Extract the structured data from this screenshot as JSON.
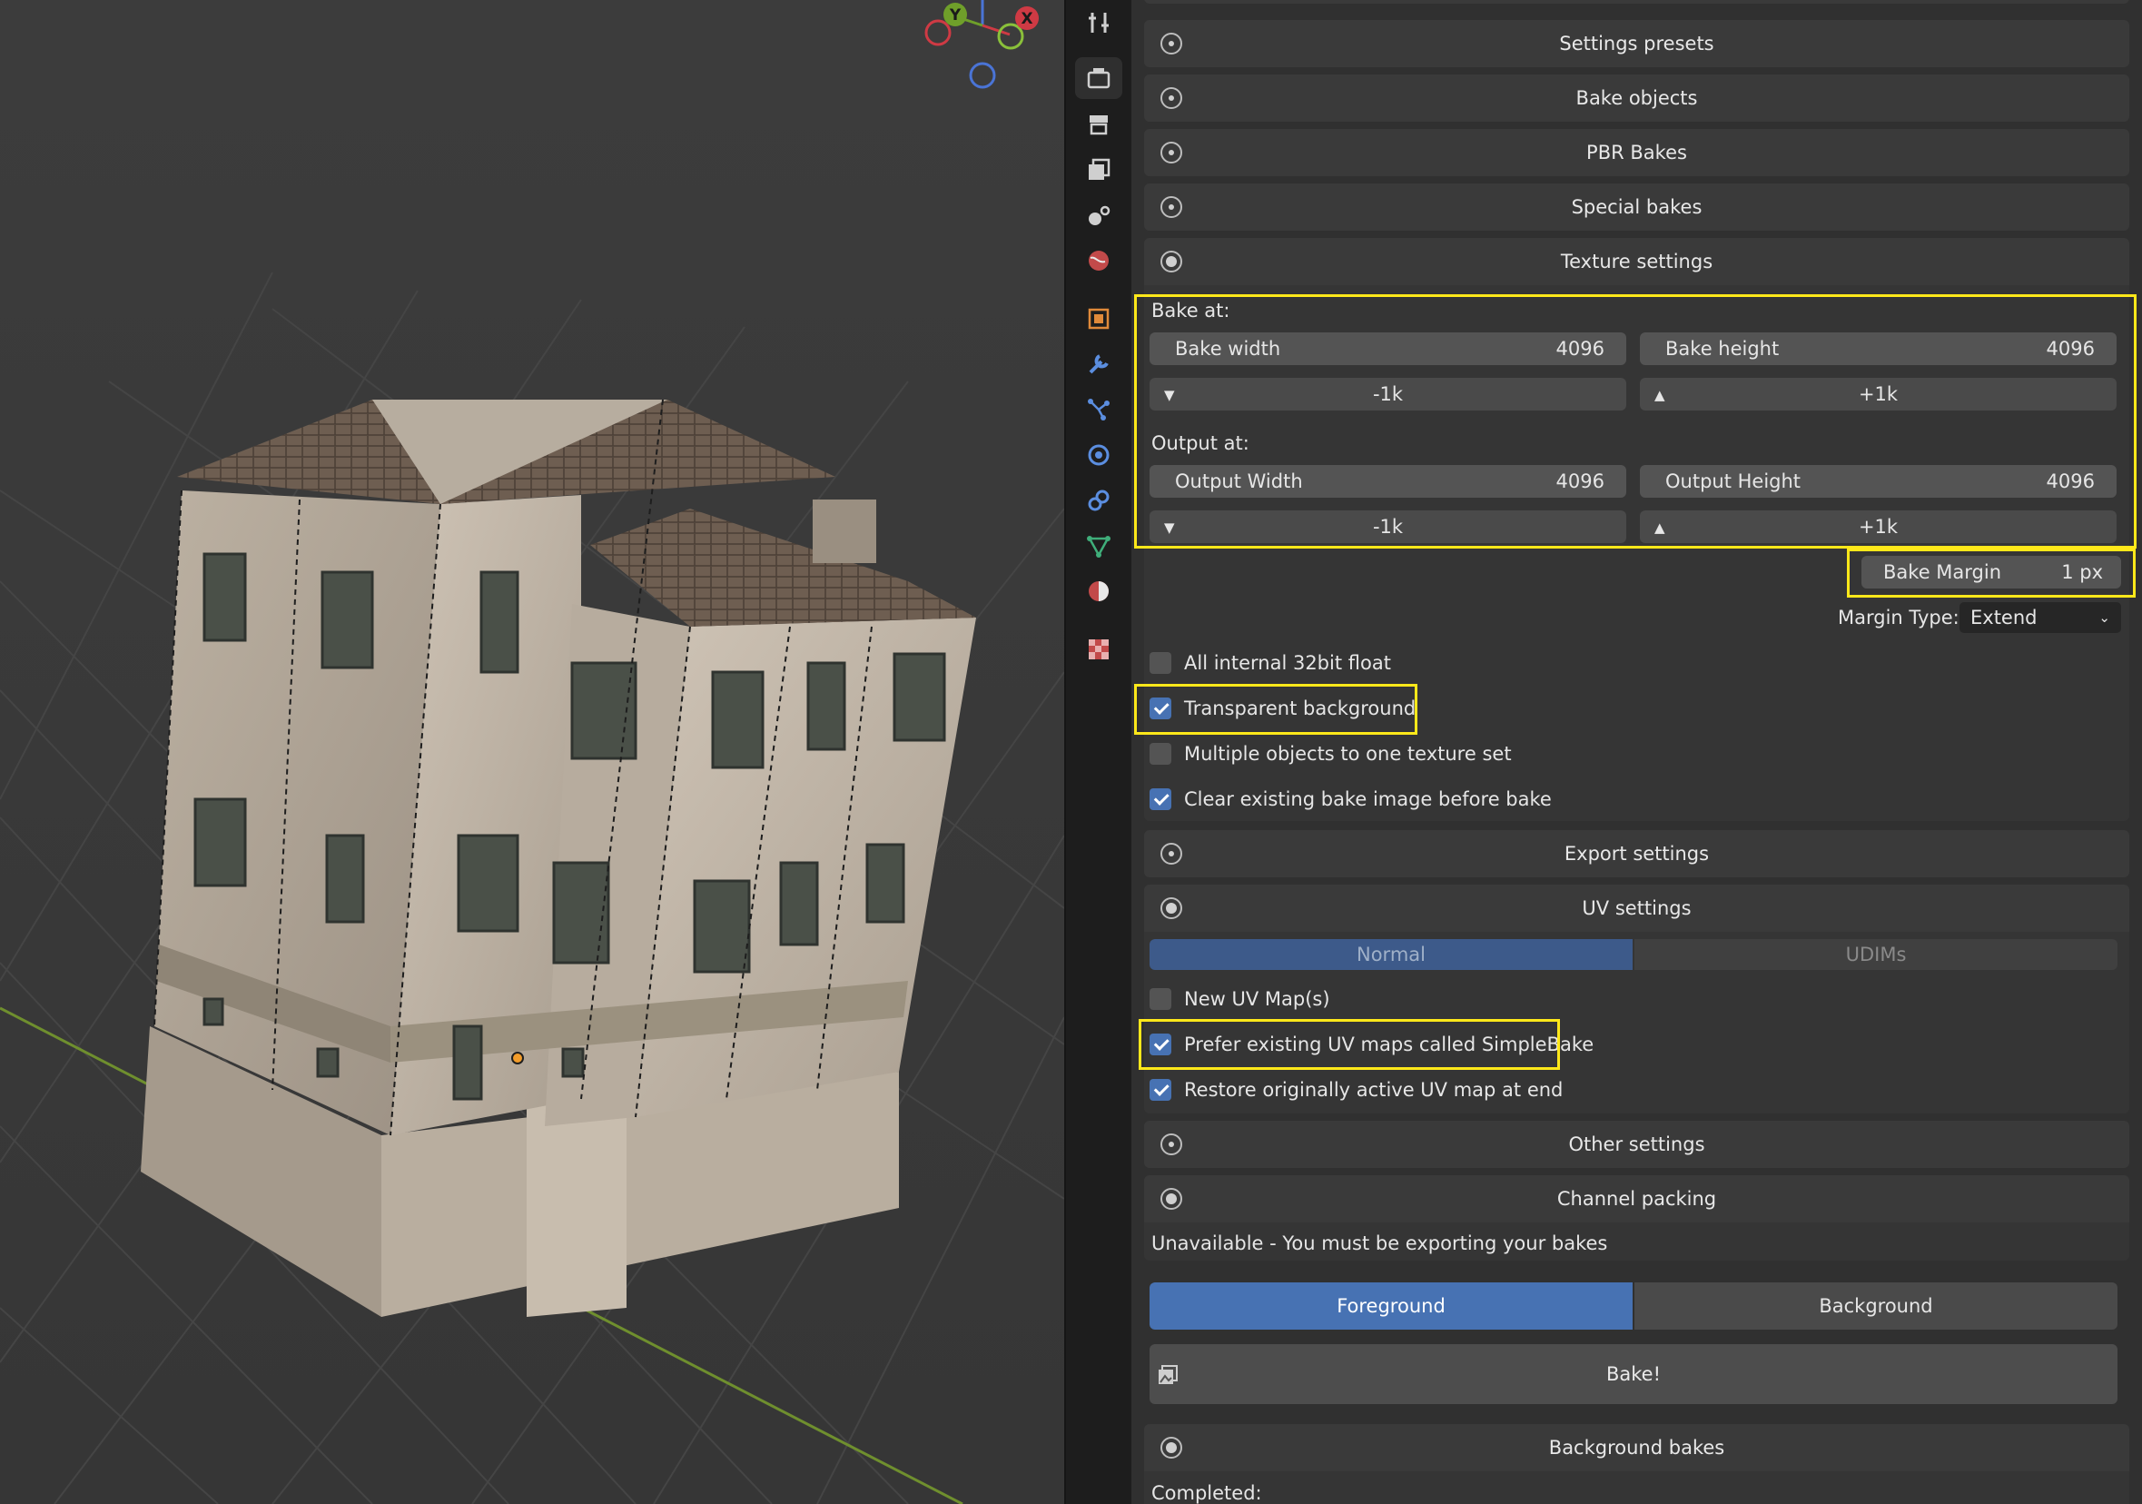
{
  "viewport": {
    "gizmo": {
      "y_axis": "Y",
      "x_axis": "X"
    }
  },
  "tabs": [
    {
      "icon": "tool-icon"
    },
    {
      "icon": "render-icon"
    },
    {
      "icon": "output-icon"
    },
    {
      "icon": "view-layer-icon"
    },
    {
      "icon": "scene-icon"
    },
    {
      "icon": "world-icon"
    },
    {
      "icon": "object-icon"
    },
    {
      "icon": "modifier-icon"
    },
    {
      "icon": "particles-icon"
    },
    {
      "icon": "physics-icon"
    },
    {
      "icon": "constraints-icon"
    },
    {
      "icon": "data-icon"
    },
    {
      "icon": "material-icon"
    },
    {
      "icon": "texture-icon"
    }
  ],
  "sections": {
    "settings_presets": "Settings presets",
    "bake_objects": "Bake objects",
    "pbr_bakes": "PBR Bakes",
    "special_bakes": "Special bakes",
    "texture_settings": "Texture settings",
    "export_settings": "Export settings",
    "uv_settings": "UV settings",
    "other_settings": "Other settings",
    "channel_packing": "Channel packing",
    "background_bakes": "Background bakes"
  },
  "texture": {
    "bake_at_label": "Bake at:",
    "bake_width_label": "Bake width",
    "bake_width_value": "4096",
    "bake_height_label": "Bake height",
    "bake_height_value": "4096",
    "minus_1k": "-1k",
    "plus_1k": "+1k",
    "output_at_label": "Output at:",
    "output_width_label": "Output Width",
    "output_width_value": "4096",
    "output_height_label": "Output Height",
    "output_height_value": "4096",
    "bake_margin_label": "Bake Margin",
    "bake_margin_value": "1 px",
    "margin_type_label": "Margin Type:",
    "margin_type_value": "Extend",
    "all_internal_32bit": "All internal 32bit float",
    "transparent_background": "Transparent background",
    "multiple_objects": "Multiple objects to one texture set",
    "clear_existing": "Clear existing bake image before bake"
  },
  "uv": {
    "mode_normal": "Normal",
    "mode_udims": "UDIMs",
    "new_uv_maps": "New UV Map(s)",
    "prefer_existing": "Prefer existing UV maps called SimpleBake",
    "restore_active": "Restore originally active UV map at end"
  },
  "channel": {
    "unavailable": "Unavailable - You must be exporting your bakes"
  },
  "bake_mode": {
    "foreground": "Foreground",
    "background": "Background",
    "bake_button": "Bake!"
  },
  "background_bakes": {
    "completed_label": "Completed:"
  },
  "colors": {
    "highlight": "#ffe81a",
    "accent": "#4772b3",
    "uv_normal_active": "#3d5a8a"
  }
}
